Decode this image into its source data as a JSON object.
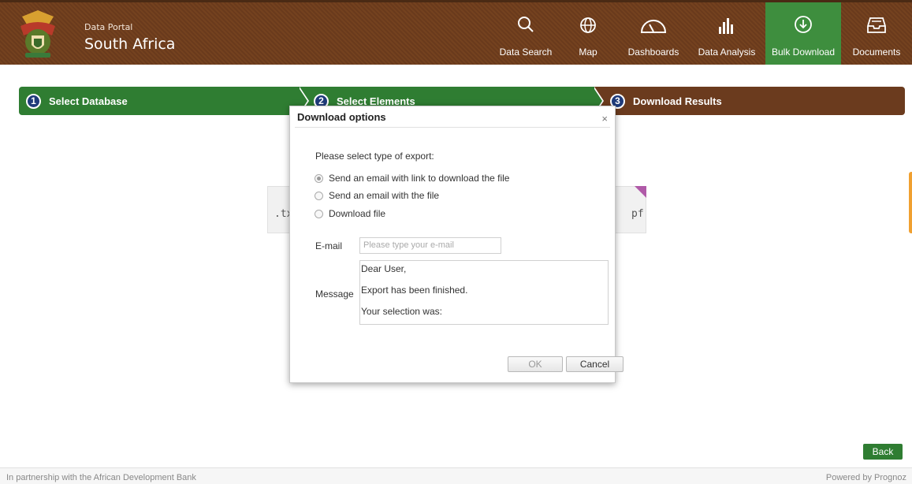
{
  "header": {
    "brand_small": "Data Portal",
    "brand_title": "South Africa",
    "nav": [
      {
        "label": "Data Search",
        "icon": "search-icon"
      },
      {
        "label": "Map",
        "icon": "globe-icon"
      },
      {
        "label": "Dashboards",
        "icon": "gauge-icon"
      },
      {
        "label": "Data Analysis",
        "icon": "bar-chart-icon"
      },
      {
        "label": "Bulk Download",
        "icon": "download-circle-icon",
        "active": true
      },
      {
        "label": "Documents",
        "icon": "inbox-icon"
      }
    ]
  },
  "steps": [
    {
      "number": "1",
      "label": "Select Database"
    },
    {
      "number": "2",
      "label": "Select Elements"
    },
    {
      "number": "3",
      "label": "Download Results"
    }
  ],
  "background_cards": {
    "left_text": ".tx",
    "right_text": "pf"
  },
  "modal": {
    "title": "Download options",
    "close": "×",
    "prompt": "Please select type of export:",
    "options": [
      {
        "label": "Send an email with link to download the file",
        "checked": true
      },
      {
        "label": "Send an email with the file",
        "checked": false
      },
      {
        "label": "Download file",
        "checked": false
      }
    ],
    "email_label": "E-mail",
    "email_placeholder": "Please type your e-mail",
    "message_label": "Message",
    "message_lines": [
      "Dear User,",
      "Export has been finished.",
      "Your selection was:"
    ],
    "ok_label": "OK",
    "cancel_label": "Cancel"
  },
  "back_label": "Back",
  "footer": {
    "left": "In partnership with the African Development Bank",
    "right": "Powered by Prognoz"
  },
  "colors": {
    "brown": "#6b3b1e",
    "green": "#2f7d32",
    "active_nav": "#3e8e3e",
    "step_number": "#1f3b7a"
  }
}
